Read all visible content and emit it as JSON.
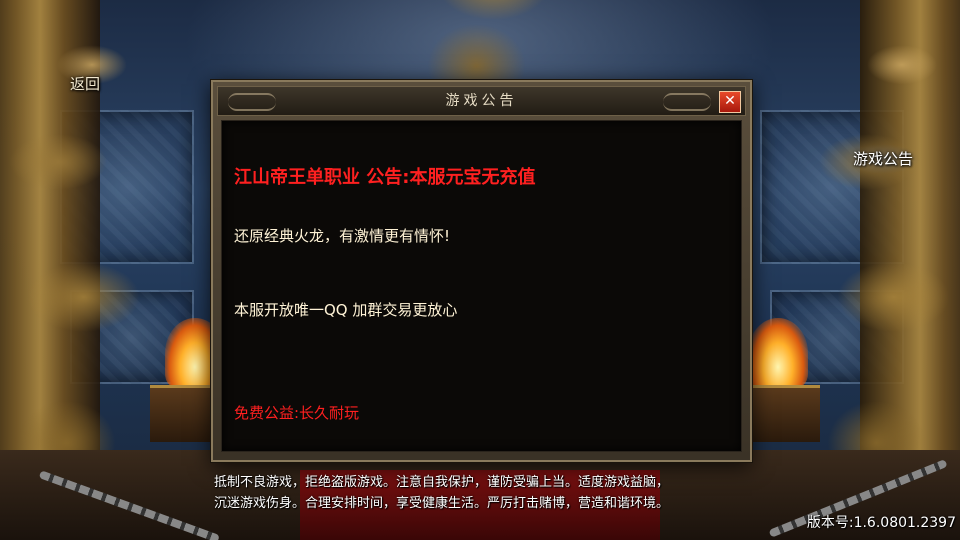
{
  "nav": {
    "back_label": "返回",
    "notice_label": "游戏公告"
  },
  "dialog": {
    "title": "游戏公告",
    "close_symbol": "✕",
    "headline": "江山帝王单职业 公告:本服元宝无充值",
    "line1": "还原经典火龙，有激情更有情怀!",
    "line2": "本服开放唯一QQ 加群交易更放心",
    "line3": "免费公益:长久耐玩"
  },
  "footer": {
    "health_line1": "抵制不良游戏，拒绝盗版游戏。注意自我保护，谨防受骗上当。适度游戏益脑，",
    "health_line2": "沉迷游戏伤身。合理安排时间，享受健康生活。严厉打击赌博，营造和谐环境。",
    "version": "版本号:1.6.0801.2397"
  },
  "colors": {
    "headline": "#ff2020",
    "body_text": "#fff3d6",
    "close_button": "#d8281a"
  }
}
